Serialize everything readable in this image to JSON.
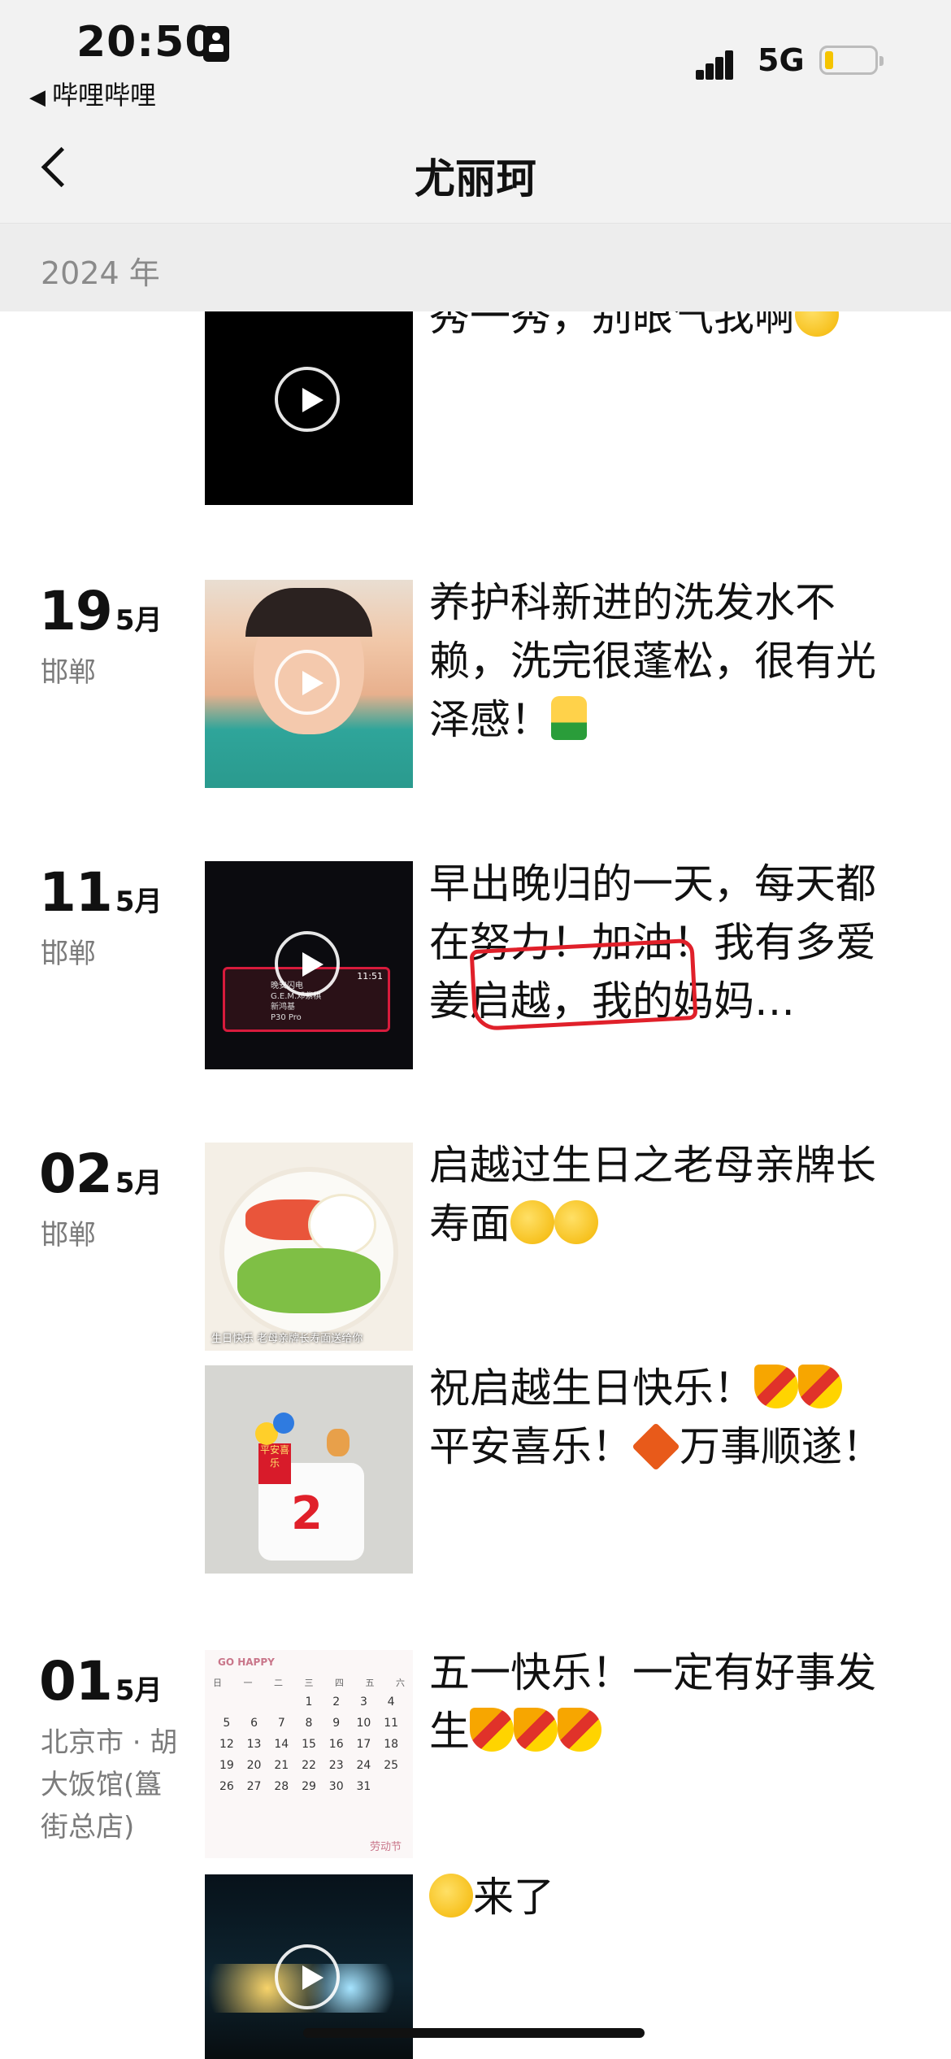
{
  "status_bar": {
    "time": "20:50",
    "back_to_app": "哔哩哔哩",
    "network": "5G"
  },
  "nav": {
    "title": "尤丽珂"
  },
  "year_header": "2024 年",
  "posts": [
    {
      "text": "秀一秀，别眼气我啊",
      "emoji": [
        "smile-face-emoji"
      ],
      "media": "video"
    },
    {
      "day": "19",
      "month": "5月",
      "location": "邯郸",
      "text": "养护科新进的洗发水不赖，洗完很蓬松，很有光泽感！",
      "emoji": [
        "thumbs-up-emoji"
      ],
      "media": "video"
    },
    {
      "day": "11",
      "month": "5月",
      "location": "邯郸",
      "text": "早出晚归的一天，每天都在努力！加油！我有多爱姜启越，我的妈妈…",
      "media": "video",
      "thumb_screen": {
        "clock": "11:51",
        "line1": "晚安闪电",
        "line2": "G.E.M.邓紫棋",
        "line3": "新鸿基",
        "freq": "P30 Pro"
      }
    },
    {
      "day": "02",
      "month": "5月",
      "location": "邯郸",
      "entries": [
        {
          "text": "启越过生日之老母亲牌长寿面",
          "emoji": [
            "pleading-face-emoji",
            "pleading-face-emoji"
          ],
          "media": "image",
          "caption": "生日快乐 老母亲牌长寿面送给你"
        },
        {
          "text_part1": "祝启越生日快乐！",
          "text_part2": "平安喜乐！",
          "text_part3": "万事顺遂！",
          "emoji": [
            "party-popper-emoji",
            "party-popper-emoji",
            "fu-diamond-emoji"
          ],
          "media": "image",
          "cake_number": "2",
          "sign": "平安喜乐"
        }
      ]
    },
    {
      "day": "01",
      "month": "5月",
      "location": "北京市 · 胡大饭馆(簋街总店)",
      "entries": [
        {
          "text": "五一快乐！一定有好事发生",
          "emoji": [
            "party-popper-emoji",
            "party-popper-emoji",
            "party-popper-emoji"
          ],
          "media": "image",
          "calendar_title": "GO HAPPY",
          "weekdays": [
            "日",
            "一",
            "二",
            "三",
            "四",
            "五",
            "六"
          ],
          "calendar_days": [
            "1",
            "2",
            "3",
            "4",
            "5",
            "6",
            "7",
            "8",
            "9",
            "10",
            "11",
            "12",
            "13",
            "14",
            "15",
            "16",
            "17",
            "18",
            "19",
            "20",
            "21",
            "22",
            "23",
            "24",
            "25",
            "26",
            "27",
            "28",
            "29",
            "30",
            "31"
          ],
          "calendar_sign": "劳动节"
        },
        {
          "text": "来了",
          "emoji": [
            "grinning-face-emoji"
          ],
          "media": "video"
        }
      ]
    }
  ],
  "colors": {
    "header_bg": "#f2f2f2",
    "year_bg": "#ededed",
    "location_text": "#7b7b7b",
    "markup_red": "#e0202a",
    "battery_yellow": "#f5c400"
  }
}
